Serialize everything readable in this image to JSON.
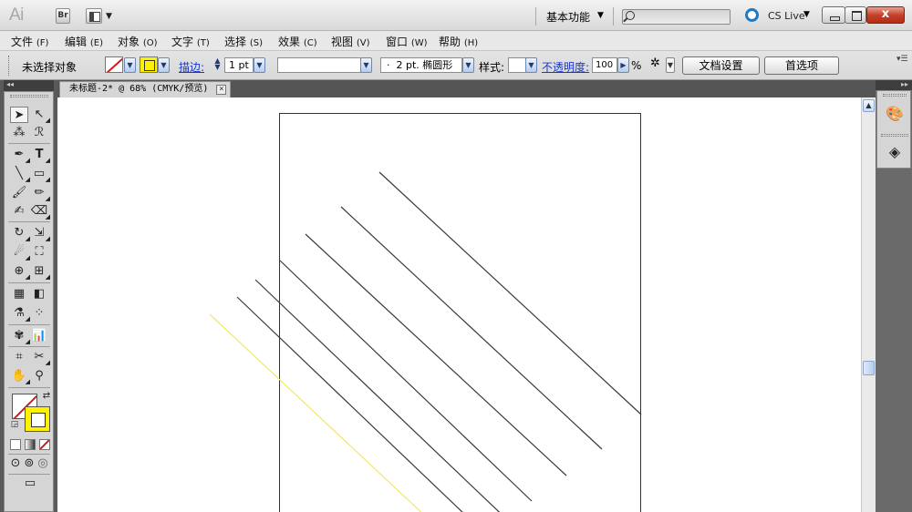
{
  "app": {
    "logo": "Ai",
    "bridge_label": "Br",
    "workspace": "基本功能",
    "cs_live": "CS Live"
  },
  "menu": [
    {
      "label": "文件",
      "accel": "(F)"
    },
    {
      "label": "编辑",
      "accel": "(E)"
    },
    {
      "label": "对象",
      "accel": "(O)"
    },
    {
      "label": "文字",
      "accel": "(T)"
    },
    {
      "label": "选择",
      "accel": "(S)"
    },
    {
      "label": "效果",
      "accel": "(C)"
    },
    {
      "label": "视图",
      "accel": "(V)"
    },
    {
      "label": "窗口",
      "accel": "(W)"
    },
    {
      "label": "帮助",
      "accel": "(H)"
    }
  ],
  "control_bar": {
    "selection_status": "未选择对象",
    "stroke_label": "描边:",
    "stroke_weight": "1 pt",
    "brush": "2 pt. 椭圆形",
    "brush_dot": "·",
    "style_label": "样式:",
    "opacity_label": "不透明度:",
    "opacity_value": "100",
    "percent": "%",
    "doc_setup_button": "文档设置",
    "preferences_button": "首选项"
  },
  "document_tab": {
    "title": "未标题-2* @ 68% (CMYK/预览)"
  },
  "colors": {
    "fill": "none",
    "stroke": "#fff200",
    "stroke_none_slash": "#d01a1a",
    "artwork_line": "#3a3a3a",
    "selected_line": "#f2e86a"
  },
  "tools": [
    "selection-tool",
    "direct-selection-tool",
    "magic-wand-tool",
    "lasso-tool",
    "pen-tool",
    "type-tool",
    "line-segment-tool",
    "rectangle-tool",
    "paintbrush-tool",
    "pencil-tool",
    "blob-brush-tool",
    "eraser-tool",
    "rotate-tool",
    "scale-tool",
    "warp-tool",
    "free-transform-tool",
    "shape-builder-tool",
    "perspective-grid-tool",
    "mesh-tool",
    "gradient-tool",
    "eyedropper-tool",
    "blend-tool",
    "symbol-sprayer-tool",
    "column-graph-tool",
    "artboard-tool",
    "slice-tool",
    "hand-tool",
    "zoom-tool"
  ]
}
